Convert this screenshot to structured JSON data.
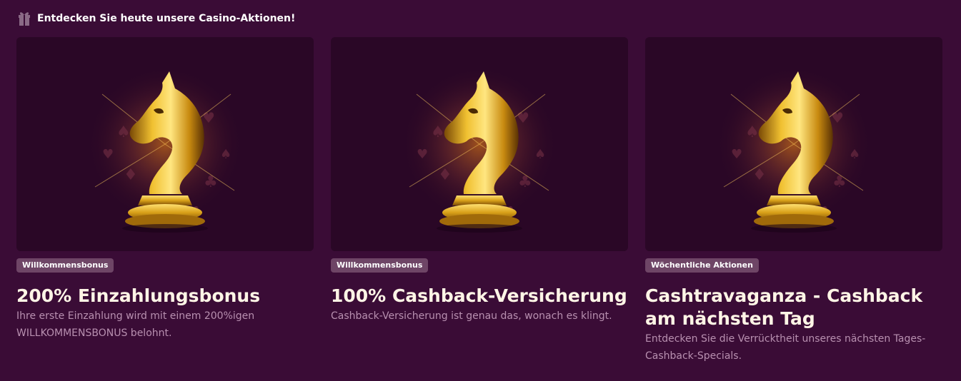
{
  "header": {
    "icon": "gift-icon",
    "title": "Entdecken Sie heute unsere Casino-Aktionen!"
  },
  "promotions": [
    {
      "image": "golden-chess-knight-image",
      "badge": "Willkommensbonus",
      "title": "200% Einzahlungsbonus",
      "description": "Ihre erste Einzahlung wird mit einem 200%igen WILLKOMMENSBONUS belohnt."
    },
    {
      "image": "golden-chess-knight-image",
      "badge": "Willkommensbonus",
      "title": "100% Cashback-Versicherung",
      "description": "Cashback-Versicherung ist genau das, wonach es klingt."
    },
    {
      "image": "golden-chess-knight-image",
      "badge": "Wöchentliche Aktionen",
      "title": "Cashtravaganza - Cashback am nächsten Tag",
      "description": "Entdecken Sie die Verrücktheit unseres nächsten Tages-Cashback-Specials."
    }
  ],
  "colors": {
    "background": "#3a0c36",
    "card_image_bg": "#2a0726",
    "badge_bg": "#6e4566",
    "heading": "#fff5e6",
    "description": "#b890b0",
    "gold": "#e0a818"
  }
}
